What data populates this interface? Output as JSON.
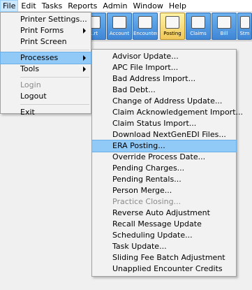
{
  "menubar": {
    "items": [
      "File",
      "Edit",
      "Tasks",
      "Reports",
      "Admin",
      "Window",
      "Help"
    ]
  },
  "toolbar": {
    "buttons": [
      "...rt",
      "Account",
      "Encounter",
      "Posting",
      "Claims",
      "Bill",
      "Stm"
    ]
  },
  "file_menu": {
    "printer_settings": "Printer Settings...",
    "print_forms": "Print Forms",
    "print_screen": "Print Screen",
    "processes": "Processes",
    "tools": "Tools",
    "login": "Login",
    "logout": "Logout",
    "exit": "Exit"
  },
  "processes_menu": {
    "items": [
      "Advisor Update...",
      "APC File Import...",
      "Bad Address Import...",
      "Bad Debt...",
      "Change of Address Update...",
      "Claim Acknowledgement Import...",
      "Claim Status Import...",
      "Download NextGenEDI Files...",
      "ERA Posting...",
      "Override Process Date...",
      "Pending Charges...",
      "Pending Rentals...",
      "Person Merge...",
      "Practice Closing...",
      "Reverse Auto Adjustment",
      "Recall Message Update",
      "Scheduling Update...",
      "Task Update...",
      "Sliding Fee Batch Adjustment",
      "Unapplied Encounter Credits"
    ]
  },
  "colors": {
    "highlight": "#91c9f7",
    "toolbar_blue": "#4a90dc",
    "menu_bg": "#f2f2f2"
  }
}
